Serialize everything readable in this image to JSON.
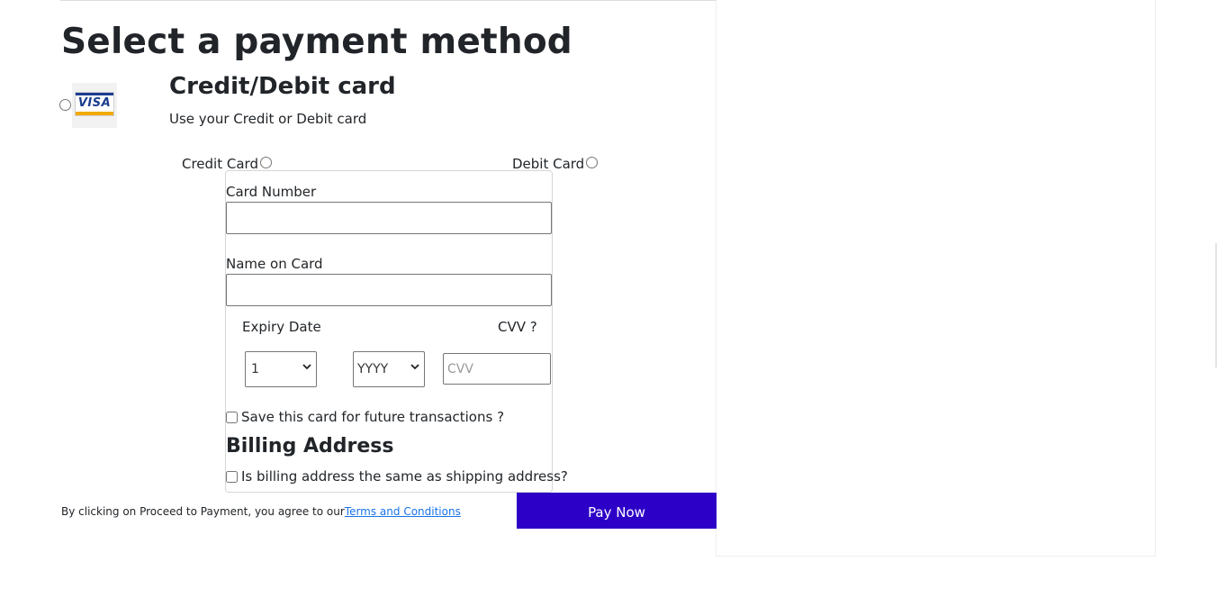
{
  "page": {
    "title": "Select a payment method"
  },
  "method": {
    "logo_text": "VISA",
    "title": "Credit/Debit card",
    "subtitle": "Use your Credit or Debit card",
    "credit_label": "Credit Card",
    "debit_label": "Debit Card"
  },
  "form": {
    "card_number_label": "Card Number",
    "card_number_value": "",
    "name_label": "Name on Card",
    "name_value": "",
    "expiry_label": "Expiry Date",
    "cvv_label": "CVV ?",
    "month_selected": "1",
    "year_selected": "YYYY",
    "cvv_placeholder": "CVV",
    "save_card_label": "Save this card for future transactions ?",
    "billing_title": "Billing Address",
    "billing_same_label": "Is billing address the same as shipping address?"
  },
  "footer": {
    "terms_prefix": "By clicking on Proceed to Payment, you agree to our",
    "terms_link": "Terms and Conditions",
    "pay_button": "Pay Now"
  },
  "colors": {
    "pay_button_bg": "#2d00c7",
    "link": "#1a73e8",
    "visa_blue": "#1a3d8f",
    "visa_gold": "#f2a900"
  }
}
